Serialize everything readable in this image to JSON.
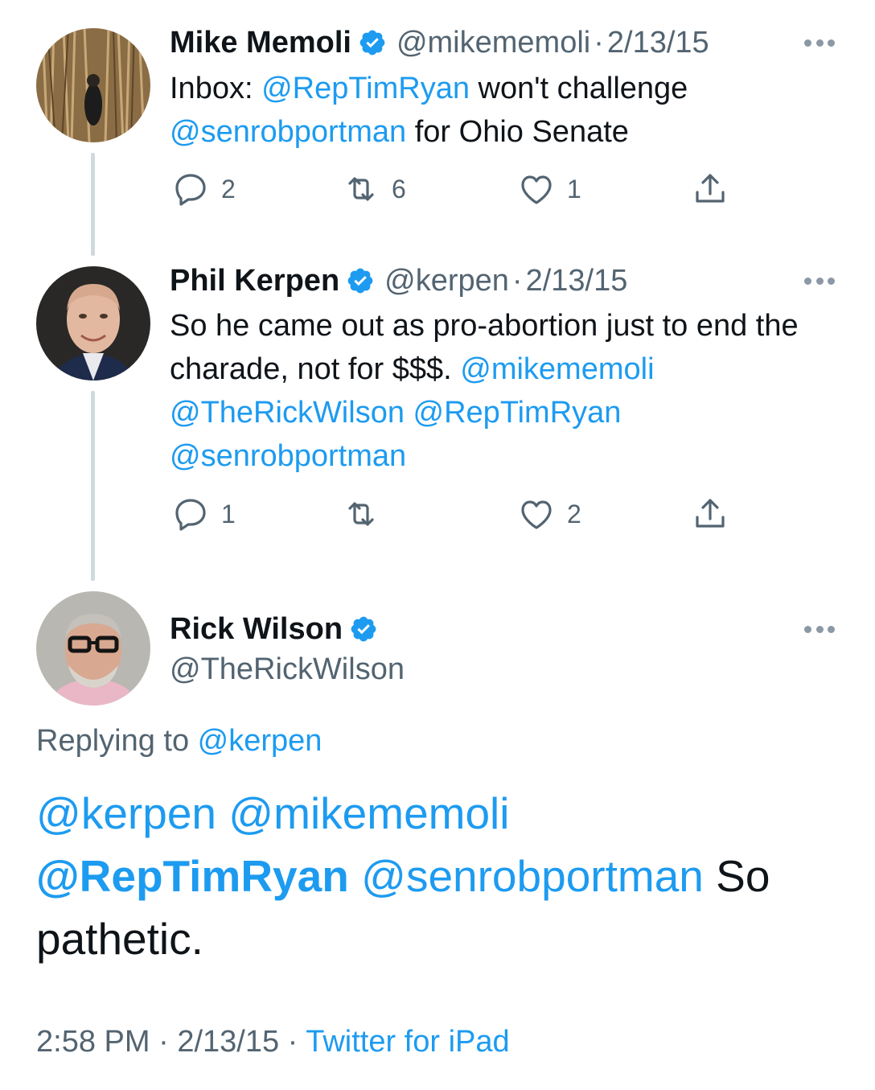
{
  "tweets": [
    {
      "name": "Mike Memoli",
      "handle": "@mikememoli",
      "separator": "·",
      "date": "2/13/15",
      "text_prefix": "Inbox: ",
      "mention1": "@RepTimRyan",
      "text_middle": " won't challenge ",
      "mention2": "@senrobportman",
      "text_suffix": " for Ohio Senate",
      "replies": "2",
      "retweets": "6",
      "likes": "1"
    },
    {
      "name": "Phil Kerpen",
      "handle": "@kerpen",
      "separator": "·",
      "date": "2/13/15",
      "text": "So he came out as pro-abortion just to end the charade, not for $$$. ",
      "mention1": "@mikememoli",
      "mention2": "@TheRickWilson",
      "mention3": "@RepTimRyan",
      "mention4": "@senrobportman",
      "replies": "1",
      "retweets": "",
      "likes": "2"
    }
  ],
  "main_tweet": {
    "name": "Rick Wilson",
    "handle": "@TheRickWilson",
    "replying_label": "Replying to ",
    "replying_to": "@kerpen",
    "mention1": "@kerpen",
    "mention2": "@mikememoli",
    "mention3": "@RepTimRyan",
    "mention4": "@senrobportman",
    "text": " So pathetic.",
    "time": "2:58 PM",
    "separator": "·",
    "date": "2/13/15",
    "source": "Twitter for iPad"
  },
  "colors": {
    "link": "#1d9bf0",
    "muted": "#536471",
    "text": "#0f1419",
    "thread_line": "#cfd9de"
  },
  "icons": [
    "verified-badge-icon",
    "more-icon",
    "reply-icon",
    "retweet-icon",
    "like-icon",
    "share-icon"
  ]
}
